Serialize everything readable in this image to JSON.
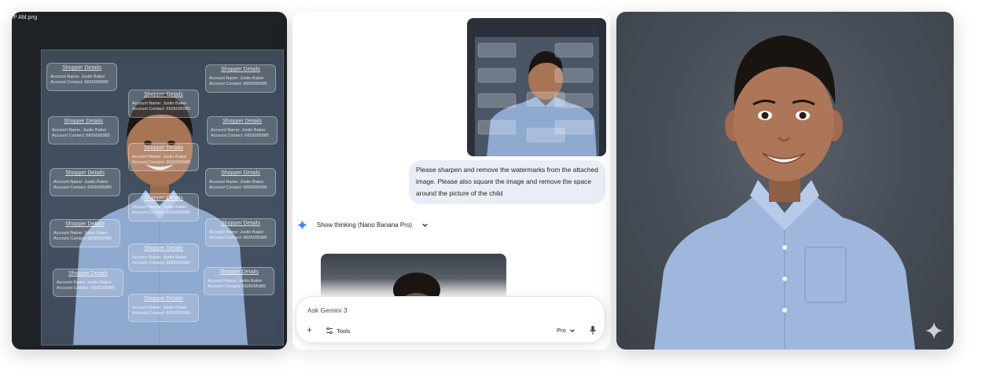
{
  "left_panel": {
    "filename_fragment": "P AM.png",
    "watermark_title": "Shopper Details",
    "watermark_line1": "Account Name: Justin Baker",
    "watermark_line2": "Account Contact: 6605095985"
  },
  "chat": {
    "user_message": "Please sharpen and remove the watermarks from the attached image. Please also square the image and remove the space around the picture of the child",
    "thinking_label": "Show thinking (Nano Banana Pro)",
    "composer": {
      "placeholder": "Ask Gemini 3",
      "tools_label": "Tools",
      "model_label": "Pro"
    }
  },
  "colors": {
    "accent_blue": "#4285f4",
    "bubble_bg": "#e9eef6",
    "shirt_blue": "#9fb7dc"
  },
  "icons": [
    "gemini-sparkle-icon",
    "chevron-down-icon",
    "plus-icon",
    "tools-icon",
    "mic-icon",
    "sparkle-watermark-icon"
  ]
}
